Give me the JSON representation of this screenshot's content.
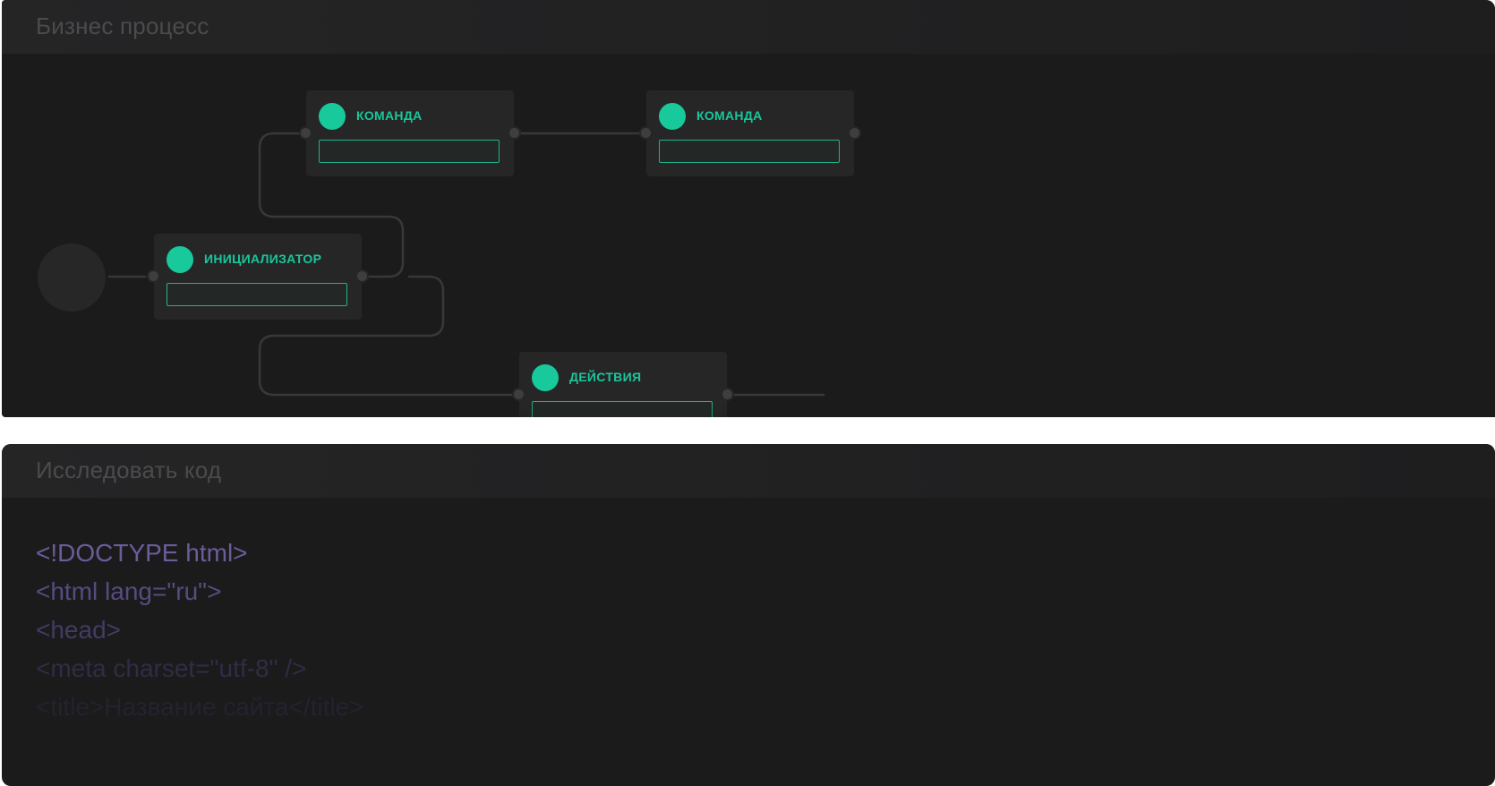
{
  "process_panel": {
    "title": "Бизнес процесс",
    "nodes": {
      "initiator": {
        "label": "ИНИЦИАЛИЗАТОР",
        "icon": "status-dot-icon"
      },
      "command_1": {
        "label": "КОМАНДА",
        "icon": "status-dot-icon"
      },
      "command_2": {
        "label": "КОМАНДА",
        "icon": "status-dot-icon"
      },
      "actions": {
        "label": "ДЕЙСТВИЯ",
        "icon": "status-dot-icon"
      }
    }
  },
  "code_panel": {
    "title": "Исследовать код",
    "lines": [
      "<!DOCTYPE html>",
      "<html lang=\"ru\">",
      "<head>",
      "<meta charset=\"utf-8\" />",
      "<title>Название сайта</title>"
    ]
  },
  "colors": {
    "background": "#1b1b1c",
    "node": "#262627",
    "accent": "#17c99b",
    "code": "#6c5c9a"
  }
}
